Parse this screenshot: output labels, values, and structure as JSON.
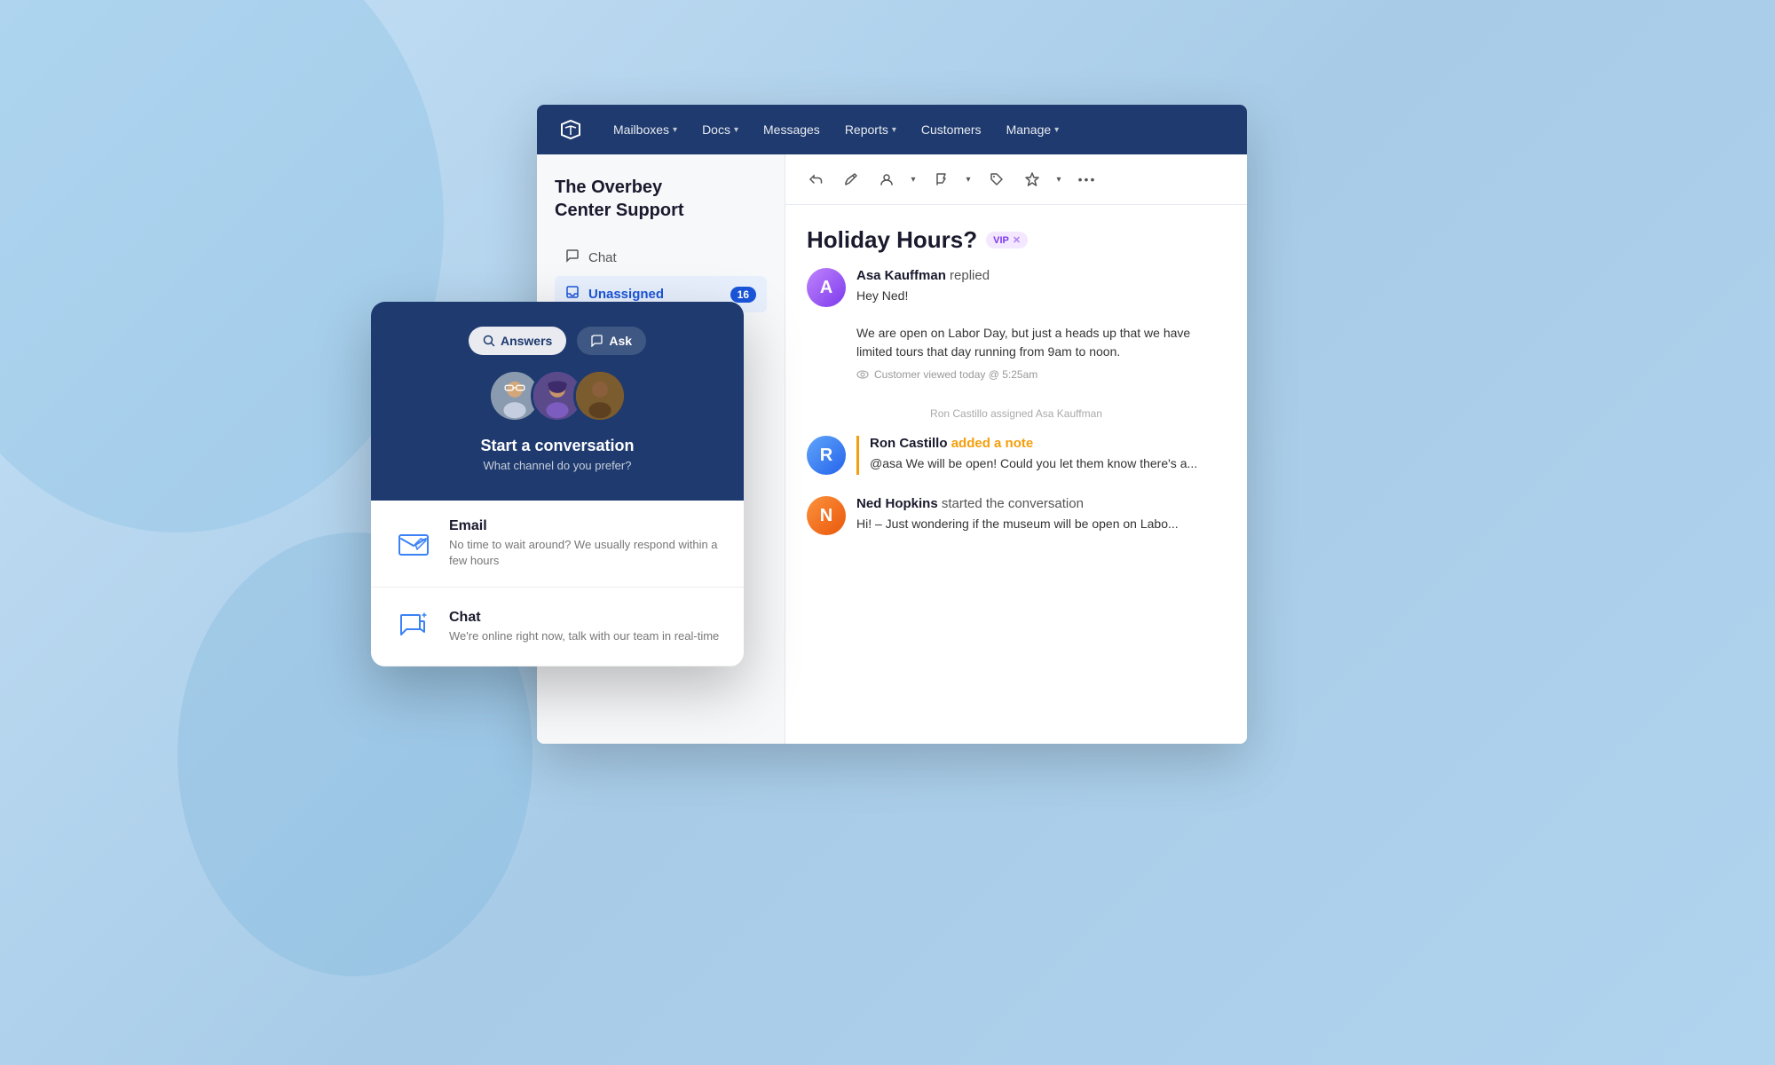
{
  "app": {
    "title": "Help Scout"
  },
  "background": {
    "color": "#b8d8f0"
  },
  "nav": {
    "items": [
      {
        "label": "Mailboxes",
        "hasDropdown": true
      },
      {
        "label": "Docs",
        "hasDropdown": true
      },
      {
        "label": "Messages",
        "hasDropdown": false
      },
      {
        "label": "Reports",
        "hasDropdown": true
      },
      {
        "label": "Customers",
        "hasDropdown": false
      },
      {
        "label": "Manage",
        "hasDropdown": true
      }
    ]
  },
  "sidebar": {
    "title": "The Overbey\nCenter Support",
    "items": [
      {
        "icon": "chat",
        "label": "Chat",
        "active": false,
        "badge": null
      },
      {
        "icon": "inbox",
        "label": "Unassigned",
        "active": true,
        "badge": "16"
      }
    ]
  },
  "conversation": {
    "title": "Holiday Hours?",
    "tag": "VIP",
    "messages": [
      {
        "author": "Asa Kauffman",
        "action": "replied",
        "avatarColor": "#7c3aed",
        "avatarBg": "#c084fc",
        "text": "Hey Ned!\n\nWe are open on Labor Day, but just a heads up that we have limited tours that day running from 9am to noon.",
        "viewedAt": "Customer viewed today @ 5:25am"
      },
      {
        "system": true,
        "text": "Ron Castillo assigned Asa Kauffman"
      },
      {
        "author": "Ron Castillo",
        "action": "added a note",
        "actionColor": "#f59e0b",
        "isNote": true,
        "avatarColor": "#2563eb",
        "avatarBg": "#60a5fa",
        "text": "@asa We will be open! Could you let them know there's a..."
      },
      {
        "author": "Ned Hopkins",
        "action": "started the conversation",
        "avatarColor": "#ea580c",
        "avatarBg": "#fb923c",
        "text": "Hi! – Just wondering if the museum will be open on Labo..."
      }
    ]
  },
  "toolbar": {
    "buttons": [
      "↩",
      "✏",
      "👤",
      "🚩",
      "🏷",
      "⚡",
      "•••"
    ]
  },
  "chatWidget": {
    "nav": [
      {
        "label": "Answers",
        "icon": "search",
        "active": true
      },
      {
        "label": "Ask",
        "icon": "chat",
        "active": false
      }
    ],
    "cta": {
      "title": "Start a conversation",
      "subtitle": "What channel do you prefer?"
    },
    "channels": [
      {
        "name": "Email",
        "description": "No time to wait around? We usually respond within a few hours",
        "icon": "email"
      },
      {
        "name": "Chat",
        "description": "We're online right now, talk with our team in real-time",
        "icon": "chat"
      }
    ]
  }
}
